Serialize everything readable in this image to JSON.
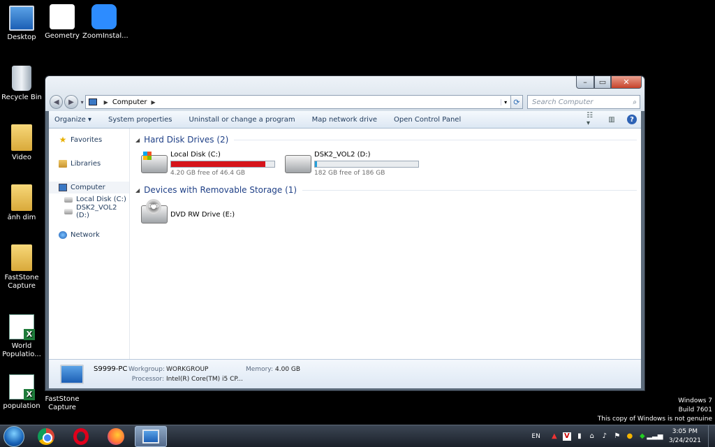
{
  "desktop": {
    "icons": [
      {
        "label": "Desktop"
      },
      {
        "label": "Geometry"
      },
      {
        "label": "ZoomInstal..."
      },
      {
        "label": "Recycle Bin"
      },
      {
        "label": "Video"
      },
      {
        "label": "ảnh dim"
      },
      {
        "label": "FastStone Capture"
      },
      {
        "label": "World Populatio..."
      },
      {
        "label": "population"
      },
      {
        "label": "FastStone Capture"
      }
    ]
  },
  "window": {
    "controls": {
      "minimize": "–",
      "maximize": "▭",
      "close": "✕"
    },
    "address": {
      "location": "Computer"
    },
    "search": {
      "placeholder": "Search Computer"
    },
    "toolbar": {
      "organize": "Organize ▾",
      "system_properties": "System properties",
      "uninstall": "Uninstall or change a program",
      "map_drive": "Map network drive",
      "control_panel": "Open Control Panel",
      "help": "?"
    },
    "nav": {
      "favorites": "Favorites",
      "libraries": "Libraries",
      "computer": "Computer",
      "local_disk": "Local Disk (C:)",
      "dsk2": "DSK2_VOL2 (D:)",
      "network": "Network"
    },
    "groups": {
      "hard_disks": "Hard Disk Drives (2)",
      "removable": "Devices with Removable Storage (1)"
    },
    "drives": [
      {
        "name": "Local Disk (C:)",
        "free": "4.20 GB free of 46.4 GB",
        "used_fraction": 0.91,
        "bar_color": "#d6141b"
      },
      {
        "name": "DSK2_VOL2 (D:)",
        "free": "182 GB free of 186 GB",
        "used_fraction": 0.02,
        "bar_color": "#26a0da"
      }
    ],
    "removable": [
      {
        "name": "DVD RW Drive (E:)"
      }
    ],
    "details": {
      "pc_name": "S9999-PC",
      "workgroup_label": "Workgroup:",
      "workgroup_value": "WORKGROUP",
      "memory_label": "Memory:",
      "memory_value": "4.00 GB",
      "processor_label": "Processor:",
      "processor_value": "Intel(R) Core(TM) i5 CP..."
    }
  },
  "watermark": {
    "line1": "Windows 7",
    "line2": "Build 7601",
    "line3": "This copy of Windows is not genuine"
  },
  "taskbar": {
    "lang": "EN",
    "time": "3:05 PM",
    "date": "3/24/2021"
  }
}
